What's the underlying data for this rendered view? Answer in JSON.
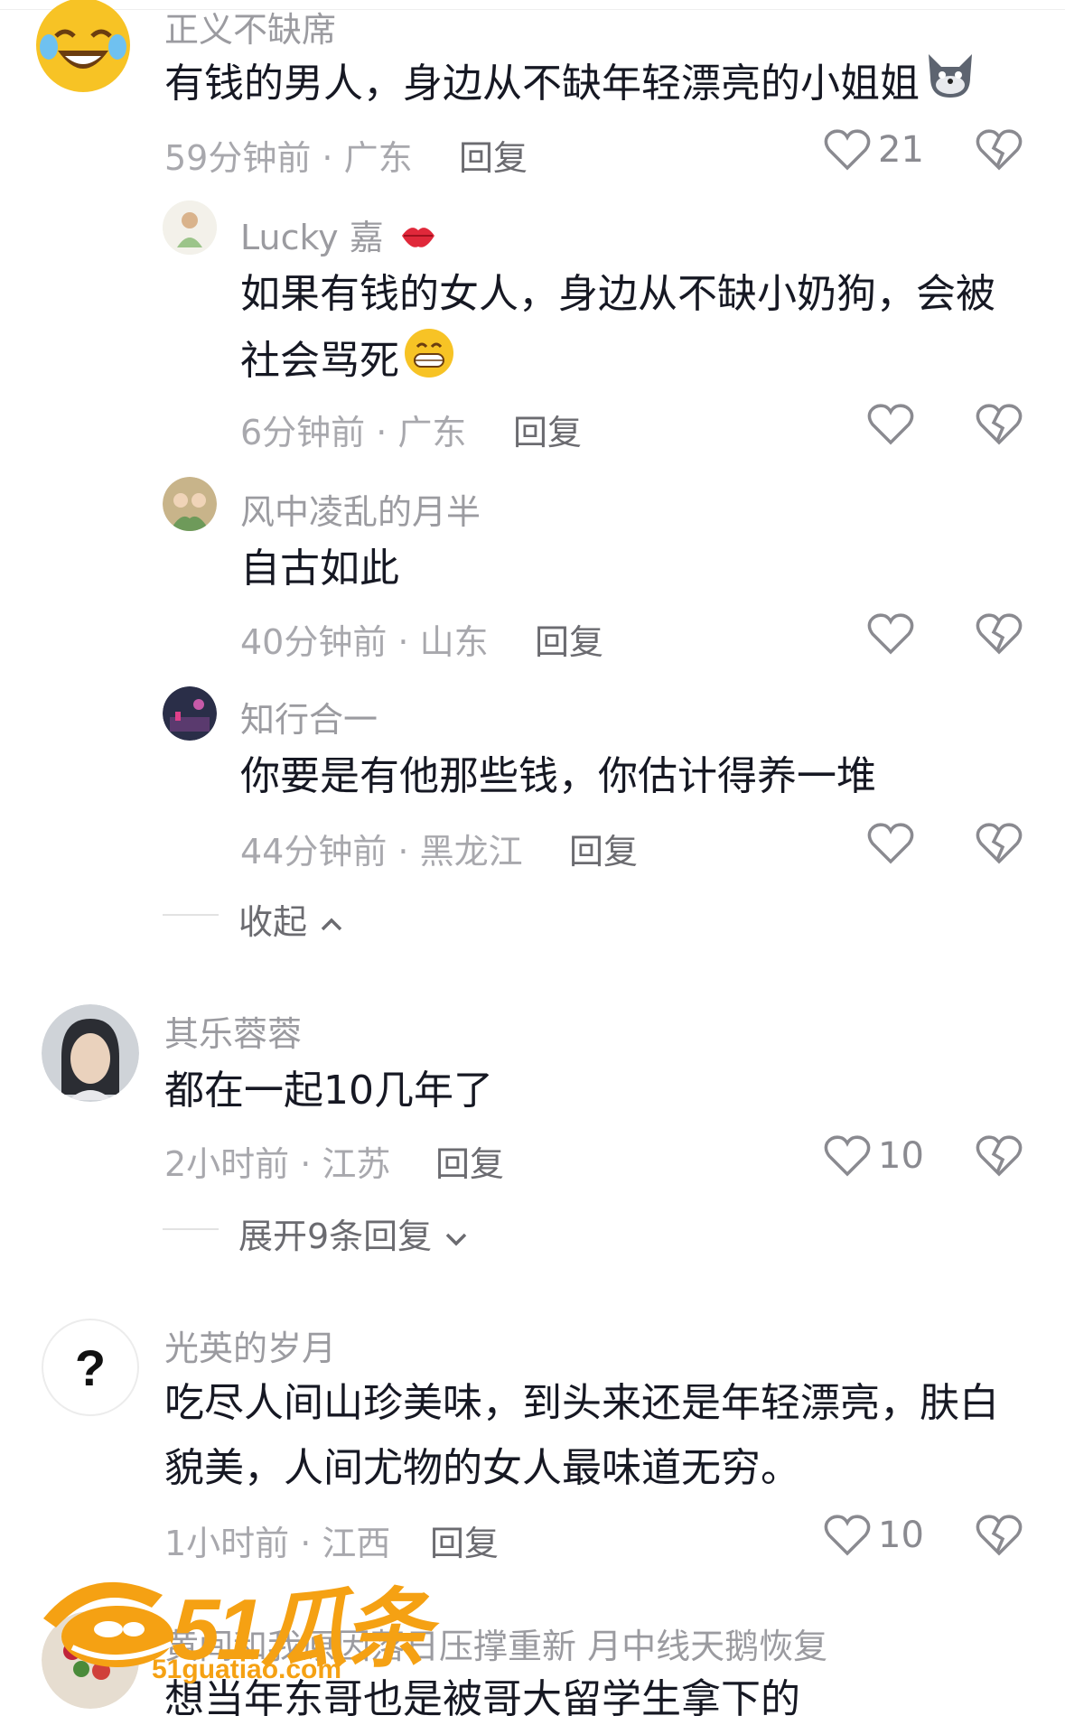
{
  "colors": {
    "text": "#161823",
    "muted": "#a8a8ad",
    "username": "#9b9ba0",
    "watermark": "#f5a113"
  },
  "comments": [
    {
      "username": "正义不缺席",
      "text": "有钱的男人，身边从不缺年轻漂亮的小姐姐",
      "emoji": "wolf-emoji",
      "time_location": "59分钟前 · 广东",
      "reply_label": "回复",
      "likes": "21",
      "avatar_icon": "laughing-crying-emoji-avatar"
    },
    {
      "username": "Lucky 嘉",
      "username_emoji": "lips-emoji",
      "text_line1": "如果有钱的女人，身边从不缺小奶狗，会被",
      "text_line2": "社会骂死",
      "emoji": "grin-emoji",
      "time_location": "6分钟前 · 广东",
      "reply_label": "回复"
    },
    {
      "username": "风中凌乱的月半",
      "text": "自古如此",
      "time_location": "40分钟前 · 山东",
      "reply_label": "回复"
    },
    {
      "username": "知行合一",
      "text": "你要是有他那些钱，你估计得养一堆",
      "time_location": "44分钟前 · 黑龙江",
      "reply_label": "回复"
    },
    {
      "username": "其乐蓉蓉",
      "text": "都在一起10几年了",
      "time_location": "2小时前 · 江苏",
      "reply_label": "回复",
      "likes": "10"
    },
    {
      "username": "光英的岁月",
      "text_line1": "吃尽人间山珍美味，到头来还是年轻漂亮，肤白",
      "text_line2": "貌美，人间尤物的女人最味道无穷。",
      "time_location": "1小时前 · 江西",
      "reply_label": "回复",
      "likes": "10"
    },
    {
      "username": "黄间和我原因落日压撑重新 月中线天鹅恢复",
      "text": "想当年东哥也是被哥大留学生拿下的"
    }
  ],
  "toggles": {
    "collapse": "收起",
    "expand": "展开9条回复"
  },
  "watermark": {
    "logo_text": "51瓜条",
    "url": "51guatiao.com"
  }
}
